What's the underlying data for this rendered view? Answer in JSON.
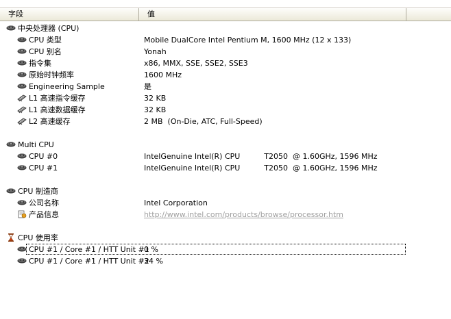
{
  "columns": {
    "field": "字段",
    "value": "值"
  },
  "sections": [
    {
      "title": "中央处理器 (CPU)",
      "icon": "cpu-chip-icon",
      "items": [
        {
          "label": "CPU 类型",
          "value": "Mobile DualCore Intel Pentium M, 1600 MHz (12 x 133)",
          "icon": "cpu-chip-icon"
        },
        {
          "label": "CPU 别名",
          "value": "Yonah",
          "icon": "cpu-chip-icon"
        },
        {
          "label": "指令集",
          "value": "x86, MMX, SSE, SSE2, SSE3",
          "icon": "cpu-chip-icon"
        },
        {
          "label": "原始时钟频率",
          "value": "1600 MHz",
          "icon": "cpu-chip-icon"
        },
        {
          "label": "Engineering Sample",
          "value": "是",
          "icon": "cpu-chip-icon"
        },
        {
          "label": "L1 高速指令缓存",
          "value": "32 KB",
          "icon": "memory-module-icon"
        },
        {
          "label": "L1 高速数据缓存",
          "value": "32 KB",
          "icon": "memory-module-icon"
        },
        {
          "label": "L2 高速缓存",
          "value": "2 MB  (On-Die, ATC, Full-Speed)",
          "icon": "memory-module-icon"
        }
      ]
    },
    {
      "title": "Multi CPU",
      "icon": "cpu-chip-icon",
      "items": [
        {
          "label": "CPU #0",
          "value": "IntelGenuine Intel(R) CPU          T2050  @ 1.60GHz, 1596 MHz",
          "icon": "cpu-chip-icon"
        },
        {
          "label": "CPU #1",
          "value": "IntelGenuine Intel(R) CPU          T2050  @ 1.60GHz, 1596 MHz",
          "icon": "cpu-chip-icon"
        }
      ]
    },
    {
      "title": "CPU 制造商",
      "icon": "cpu-chip-icon",
      "items": [
        {
          "label": "公司名称",
          "value": "Intel Corporation",
          "icon": "cpu-chip-icon"
        },
        {
          "label": "产品信息",
          "value": "http://www.intel.com/products/browse/processor.htm",
          "icon": "info-document-icon",
          "link": true
        }
      ]
    },
    {
      "title": "CPU 使用率",
      "icon": "hourglass-icon",
      "items": [
        {
          "label": "CPU #1 / Core #1 / HTT Unit #1",
          "value": "0 %",
          "icon": "cpu-chip-icon",
          "selected": true
        },
        {
          "label": "CPU #1 / Core #1 / HTT Unit #2",
          "value": "34 %",
          "icon": "cpu-chip-icon"
        }
      ]
    }
  ]
}
